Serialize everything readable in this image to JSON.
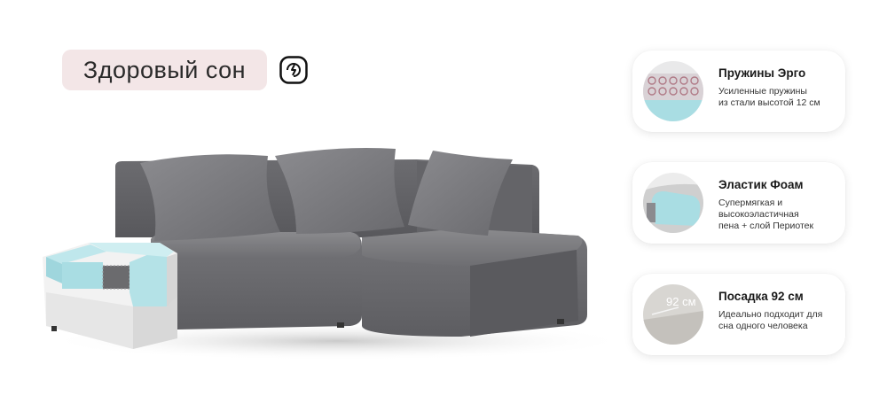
{
  "badge": {
    "label": "Здоровый сон",
    "icon": "health-shield-icon"
  },
  "features": [
    {
      "title": "Пружины Эрго",
      "lines": [
        "Усиленные пружины",
        "из стали высотой 12 см"
      ],
      "icon": "springs-thumbnail"
    },
    {
      "title": "Эластик Фоам",
      "lines": [
        "Супермягкая и",
        "высокоэластичная",
        "пена + слой Периотек"
      ],
      "icon": "foam-thumbnail"
    },
    {
      "title": "Посадка 92 см",
      "lines": [
        "Идеально подходит для",
        "сна одного человека"
      ],
      "icon": "seat-depth-thumbnail",
      "measure_label": "92 см"
    }
  ],
  "colors": {
    "fabric": "#7d7d80",
    "fabric_dark": "#5e5e62",
    "foam": "#a9dde3",
    "badge_bg": "#f3e6e7"
  }
}
